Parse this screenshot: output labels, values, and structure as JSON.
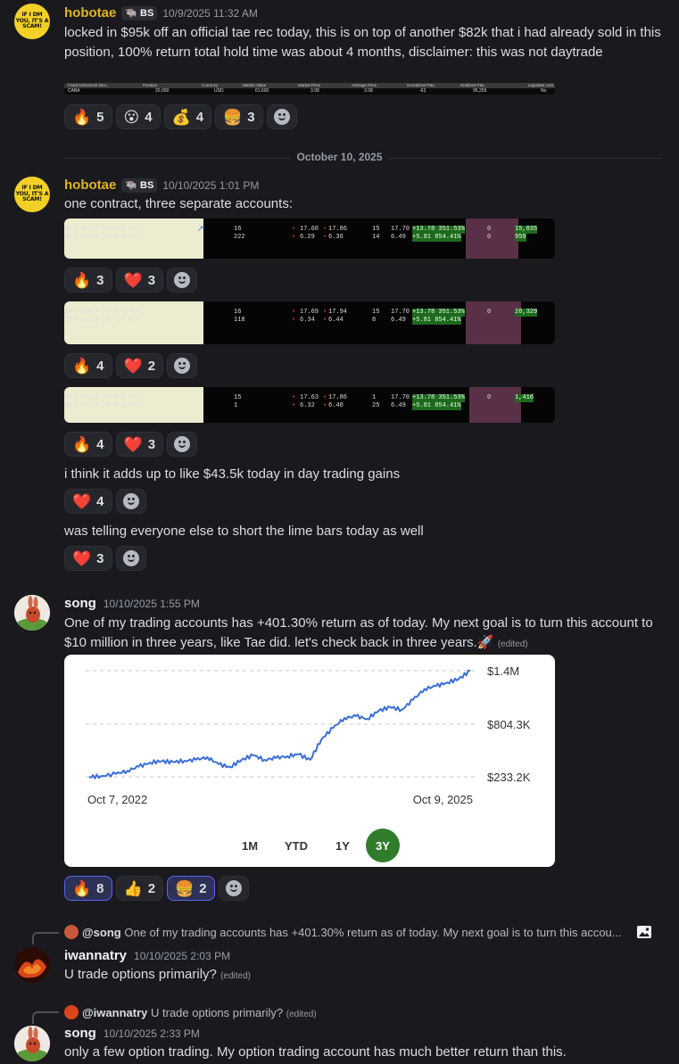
{
  "divider": {
    "date": "October 10, 2025"
  },
  "msg1": {
    "avatar_text": "IF I DM YOU, IT'S A SCAM!",
    "username": "hobotae",
    "tag": "BS",
    "timestamp": "10/9/2025 11:32 AM",
    "text": "locked in $95k off an official tae rec today, this is on top of another $82k that i had already sold in this position, 100% return total hold time was about 4 months, disclaimer: this was not daytrade",
    "table_headers": [
      "Fixed Instrument Des...",
      "Position",
      "Currency",
      "Market Value",
      "Market Price",
      "Average Price",
      "Unrealized P&L",
      "Realized P&L",
      "Liquidate Last"
    ],
    "table_row": [
      "CABA",
      "20,000",
      "USD",
      "61,600",
      "3.08",
      "3.08",
      "-63",
      "95,259",
      "No"
    ],
    "reactions": [
      {
        "emoji": "🔥",
        "count": "5"
      },
      {
        "emoji": "😮",
        "count": "4"
      },
      {
        "emoji": "💰",
        "count": "4"
      },
      {
        "emoji": "🍔",
        "count": "3"
      }
    ]
  },
  "msg2": {
    "avatar_text": "IF I DM YOU, IT'S A SCAM!",
    "username": "hobotae",
    "tag": "BS",
    "timestamp": "10/10/2025 1:01 PM",
    "text": "one contract, three separate accounts:",
    "shots": [
      {
        "rows": [
          {
            "desc": "SPY Oct17'25 670 PUT",
            "pos": "16",
            "p1": "17.60",
            "p2": "17.86",
            "q": "15",
            "last": "17.70",
            "chg": "+13.78",
            "pct": "351.53%",
            "z": "0",
            "val": "15,835"
          },
          {
            "desc": "SPY Oct15'25 654 PUT",
            "pos": "222",
            "p1": "6.29",
            "p2": "6.36",
            "q": "14",
            "last": "6.49",
            "chg": "+5.81",
            "pct": "854.41%",
            "z": "0",
            "val": "959"
          }
        ],
        "reactions": [
          {
            "emoji": "🔥",
            "count": "3"
          },
          {
            "emoji": "❤️",
            "count": "3"
          }
        ]
      },
      {
        "rows": [
          {
            "desc": "SPY Oct17'25 670 PUT",
            "pos": "16",
            "p1": "17.69",
            "p2": "17.94",
            "q": "15",
            "last": "17.70",
            "chg": "+13.78",
            "pct": "351.53%",
            "z": "0",
            "val": "26,329"
          },
          {
            "desc": "SPY Oct15'25 654 PUT",
            "pos": "118",
            "p1": "6.34",
            "p2": "6.44",
            "q": "8",
            "last": "6.49",
            "chg": "+5.81",
            "pct": "854.41%",
            "z": "",
            "val": ""
          }
        ],
        "reactions": [
          {
            "emoji": "🔥",
            "count": "4"
          },
          {
            "emoji": "❤️",
            "count": "2"
          }
        ]
      },
      {
        "rows": [
          {
            "desc": "SPY Oct17'25 670 PUT",
            "pos": "15",
            "p1": "17.63",
            "p2": "17.86",
            "q": "1",
            "last": "17.70",
            "chg": "+13.78",
            "pct": "351.53%",
            "z": "0",
            "val": "1,416"
          },
          {
            "desc": "SPY Oct15'25 654 PUT",
            "pos": "1",
            "p1": "6.32",
            "p2": "6.40",
            "q": "25",
            "last": "6.49",
            "chg": "+5.81",
            "pct": "854.41%",
            "z": "",
            "val": ""
          }
        ],
        "reactions": [
          {
            "emoji": "🔥",
            "count": "4"
          },
          {
            "emoji": "❤️",
            "count": "3"
          }
        ]
      }
    ],
    "followups": [
      {
        "text": "i think it adds up to like $43.5k today in day trading gains",
        "reactions": [
          {
            "emoji": "❤️",
            "count": "4"
          }
        ]
      },
      {
        "text": "was telling everyone else to short the lime bars today as well",
        "reactions": [
          {
            "emoji": "❤️",
            "count": "3"
          }
        ]
      }
    ]
  },
  "msg3": {
    "username": "song",
    "timestamp": "10/10/2025 1:55 PM",
    "text": "One of my trading accounts has +401.30% return as of today. My next goal is to turn this account to $10 million in three years, like Tae did. let's check back in three years.",
    "rocket": "🚀",
    "edited": "(edited)",
    "ranges": [
      "1M",
      "YTD",
      "1Y",
      "3Y"
    ],
    "selected_range": "3Y",
    "reactions": [
      {
        "emoji": "🔥",
        "count": "8",
        "active": true
      },
      {
        "emoji": "👍",
        "count": "2"
      },
      {
        "emoji": "🍔",
        "count": "2",
        "active": true
      }
    ]
  },
  "chart_data": {
    "type": "line",
    "x_start": "Oct 7, 2022",
    "x_end": "Oct 9, 2025",
    "y_ticks": [
      "$1.4M",
      "$804.3K",
      "$233.2K"
    ],
    "ylim": [
      233200,
      1400000
    ],
    "line_color": "#3b6fd6",
    "x_frac": [
      0,
      0.03,
      0.07,
      0.1,
      0.13,
      0.16,
      0.19,
      0.22,
      0.25,
      0.28,
      0.31,
      0.34,
      0.37,
      0.4,
      0.43,
      0.46,
      0.49,
      0.52,
      0.55,
      0.58,
      0.61,
      0.64,
      0.67,
      0.7,
      0.73,
      0.76,
      0.79,
      0.82,
      0.85,
      0.88,
      0.91,
      0.94,
      0.97,
      1
    ],
    "values": [
      233000,
      240000,
      265000,
      300000,
      345000,
      390000,
      405000,
      395000,
      410000,
      420000,
      450000,
      370000,
      340000,
      420000,
      470000,
      420000,
      440000,
      460000,
      480000,
      420000,
      650000,
      770000,
      880000,
      900000,
      870000,
      960000,
      1000000,
      970000,
      1080000,
      1200000,
      1230000,
      1270000,
      1310000,
      1400000
    ]
  },
  "msg4": {
    "reply_user": "@song",
    "reply_text": "One of my trading accounts has +401.30% return as of today. My next goal is to turn this accou...",
    "username": "iwannatry",
    "timestamp": "10/10/2025 2:03 PM",
    "text": "U trade options primarily?",
    "edited": "(edited)"
  },
  "msg5": {
    "reply_user": "@iwannatry",
    "reply_text": "U trade options primarily?",
    "reply_edited": "(edited)",
    "username": "song",
    "timestamp": "10/10/2025 2:33 PM",
    "text": "only a few option trading. My option trading account has much better return than this."
  }
}
